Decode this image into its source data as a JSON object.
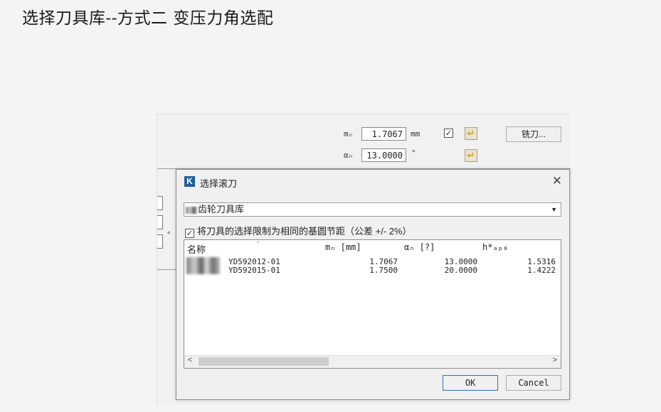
{
  "slide": {
    "title": "选择刀具库--方式二   变压力角选配"
  },
  "params": {
    "module_label": "mₙ",
    "module_value": "1.7067",
    "module_unit": "mm",
    "angle_label": "αₙ",
    "angle_value": "13.0000",
    "angle_unit": "°",
    "tool_button": "铣刀...",
    "left_degree": "°"
  },
  "dialog": {
    "logo": "K",
    "title": "选择滚刀",
    "close": "✕",
    "library_label": "齿轮刀具库",
    "restrict_label": "将刀具的选择限制为相同的基圆节距（公差 +/- 2%）",
    "columns": [
      "名称",
      "mₙ [mm]",
      "αₙ [?]",
      "h*ₐₚ₀"
    ],
    "rows": [
      {
        "name": "YD592012-01",
        "mn": "1.7067",
        "alpha": "13.0000",
        "hap": "1.5316"
      },
      {
        "name": "YD592015-01",
        "mn": "1.7500",
        "alpha": "20.0000",
        "hap": "1.4222"
      }
    ],
    "ok_label": "OK",
    "cancel_label": "Cancel"
  },
  "icons": {
    "check": "✓",
    "apply_arrow": "↵",
    "caret": "▼",
    "scroll_left": "<",
    "scroll_right": ">"
  }
}
